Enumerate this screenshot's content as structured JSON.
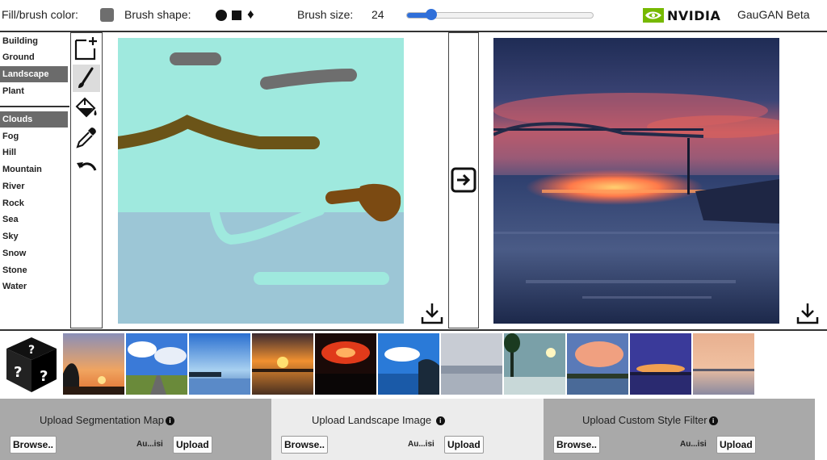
{
  "toolbar": {
    "fill_label": "Fill/brush color:",
    "brush_color": "#6e6e6e",
    "shape_label": "Brush shape:",
    "shapes": [
      "circle",
      "square",
      "diamond"
    ],
    "size_label": "Brush size:",
    "size_value": "24",
    "size_fraction": 0.13,
    "brand_name": "NVIDIA",
    "app_title": "GauGAN Beta"
  },
  "labels": {
    "group1": [
      "Building",
      "Ground",
      "Landscape",
      "Plant"
    ],
    "group2": [
      "Clouds",
      "Fog",
      "Hill",
      "Mountain",
      "River",
      "Rock",
      "Sea",
      "Sky",
      "Snow",
      "Stone",
      "Water"
    ],
    "selected_group1": "Landscape",
    "selected_group2": "Clouds"
  },
  "tools": [
    "new-canvas-icon",
    "brush-icon",
    "fill-bucket-icon",
    "eyedropper-icon",
    "undo-icon"
  ],
  "colors": {
    "sky": "#9fe9de",
    "sea": "#9cc6d6",
    "brush_brown": "#6b5418",
    "blob_brown": "#7b4a12",
    "cloud_gray": "#6e6e6e",
    "accent_blue": "#2f6fd9",
    "nvidia_green": "#76b900",
    "panel_gray": "#a9a9a9"
  },
  "thumbnails": [
    "sunset-trees",
    "clouds-road",
    "blue-sky-lake",
    "sunset-lake",
    "red-sunset",
    "coastal-cliffs",
    "grey-beach",
    "tree-water",
    "pink-clouds",
    "purple-sunset",
    "calm-sunset"
  ],
  "uploads": [
    {
      "title": "Upload Segmentation Map",
      "browse": "Browse..",
      "file": "Au...isi",
      "upload": "Upload"
    },
    {
      "title": "Upload Landscape Image",
      "browse": "Browse..",
      "file": "Au...isi",
      "upload": "Upload"
    },
    {
      "title": "Upload Custom Style Filter",
      "browse": "Browse..",
      "file": "Au...isi",
      "upload": "Upload"
    }
  ]
}
